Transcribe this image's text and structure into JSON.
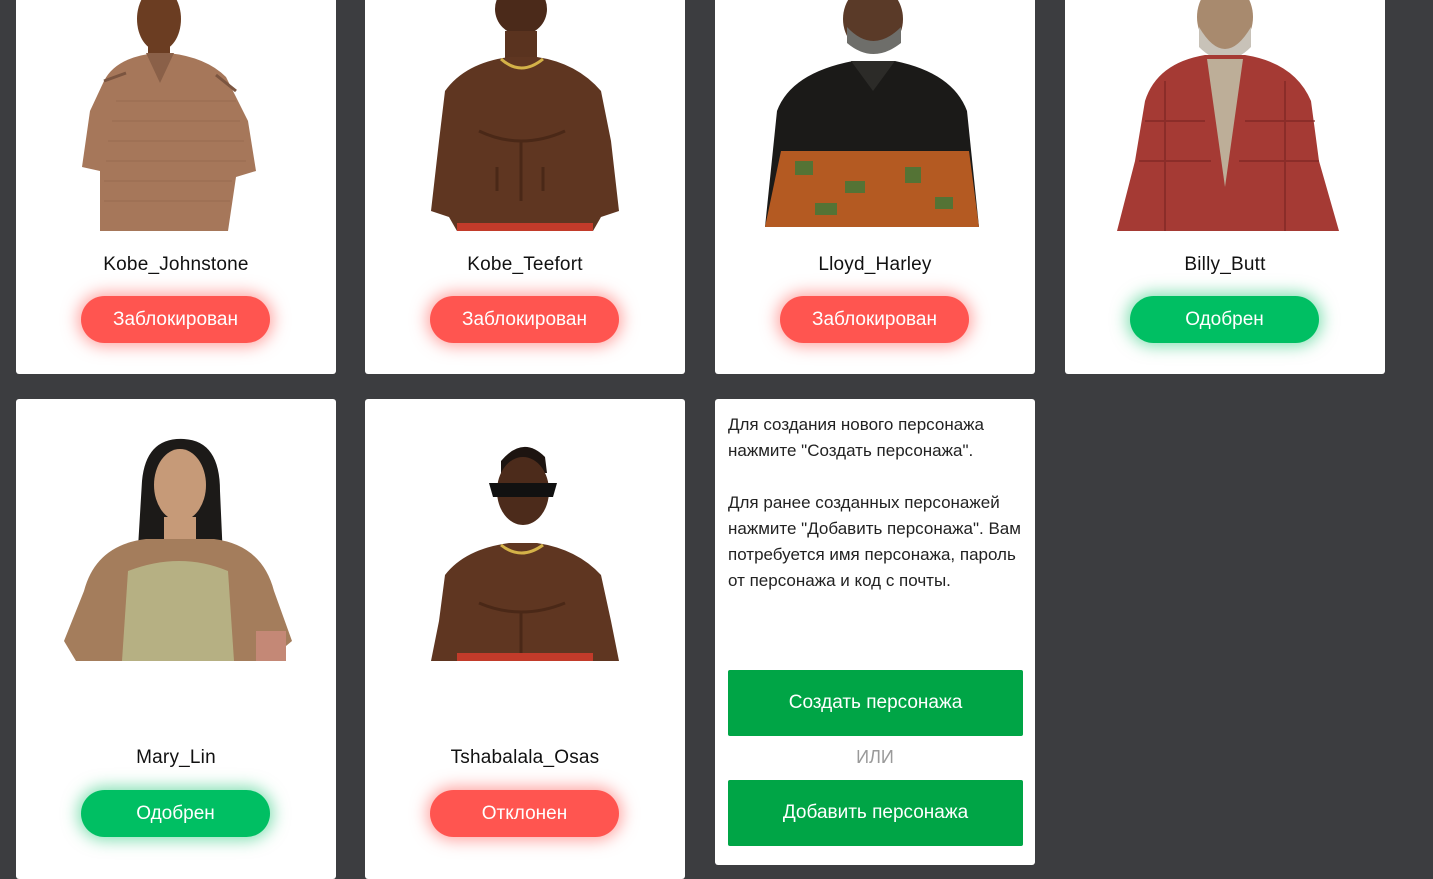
{
  "characters": [
    {
      "name": "Kobe_Johnstone",
      "status": "Заблокирован",
      "status_color": "#ff5550"
    },
    {
      "name": "Kobe_Teefort",
      "status": "Заблокирован",
      "status_color": "#ff5550"
    },
    {
      "name": "Lloyd_Harley",
      "status": "Заблокирован",
      "status_color": "#ff5550"
    },
    {
      "name": "Billy_Butt",
      "status": "Одобрен",
      "status_color": "#00bf63"
    },
    {
      "name": "Mary_Lin",
      "status": "Одобрен",
      "status_color": "#00bf63"
    },
    {
      "name": "Tshabalala_Osas",
      "status": "Отклонен",
      "status_color": "#ff5550"
    }
  ],
  "info_panel": {
    "paragraph1": "Для создания нового персонажа нажмите \"Создать персонажа\".",
    "paragraph2": "Для ранее созданных персонажей нажмите \"Добавить персонажа\". Вам потребуется имя персонажа, пароль от персонажа и код с почты.",
    "create_button": "Создать персонажа",
    "or_label": "ИЛИ",
    "add_button": "Добавить персонажа",
    "button_color": "#00a546"
  },
  "colors": {
    "background": "#3c3d40",
    "card": "#ffffff",
    "blocked": "#ff5550",
    "approved": "#00bf63"
  }
}
